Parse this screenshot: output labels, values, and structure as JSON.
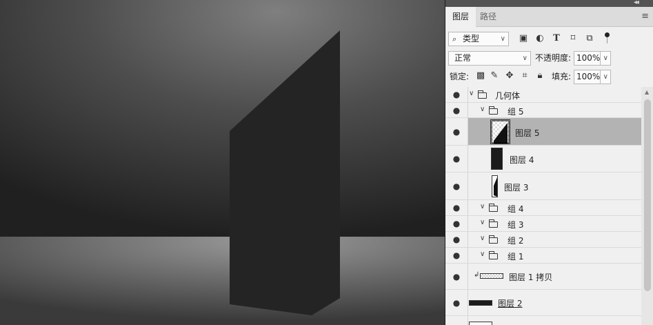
{
  "tabs": [
    {
      "label": "图层"
    },
    {
      "label": "路径"
    }
  ],
  "filter": {
    "kind": "类型"
  },
  "blend": {
    "mode": "正常",
    "opacity_label": "不透明度:",
    "opacity": "100%"
  },
  "lock": {
    "label": "锁定:",
    "fill_label": "填充:",
    "fill": "100%"
  },
  "layers": [
    {
      "name": "几何体",
      "type": "group"
    },
    {
      "name": "组 5",
      "type": "group"
    },
    {
      "name": "图层 5",
      "type": "layer",
      "selected": true
    },
    {
      "name": "图层 4",
      "type": "layer"
    },
    {
      "name": "图层 3",
      "type": "layer"
    },
    {
      "name": "组 4",
      "type": "group"
    },
    {
      "name": "组 3",
      "type": "group"
    },
    {
      "name": "组 2",
      "type": "group"
    },
    {
      "name": "组 1",
      "type": "group"
    },
    {
      "name": "图层 1 拷贝",
      "type": "layer"
    },
    {
      "name": "图层 2",
      "type": "layer"
    }
  ],
  "icons": [
    "search-icon",
    "image-filter-icon",
    "adjustment-filter-icon",
    "text-filter-icon",
    "shape-filter-icon",
    "smart-object-filter-icon",
    "filter-toggle-icon",
    "lock-pixels-icon",
    "lock-paint-icon",
    "lock-move-icon",
    "lock-artboard-icon",
    "lock-all-icon",
    "eye-icon",
    "folder-icon",
    "panel-menu-icon"
  ],
  "colors": {
    "panel_bg": "#f0f0f0",
    "selected_row": "#b3b3b3",
    "canvas_dark": "#2d2d2d",
    "shape": "#242424"
  }
}
